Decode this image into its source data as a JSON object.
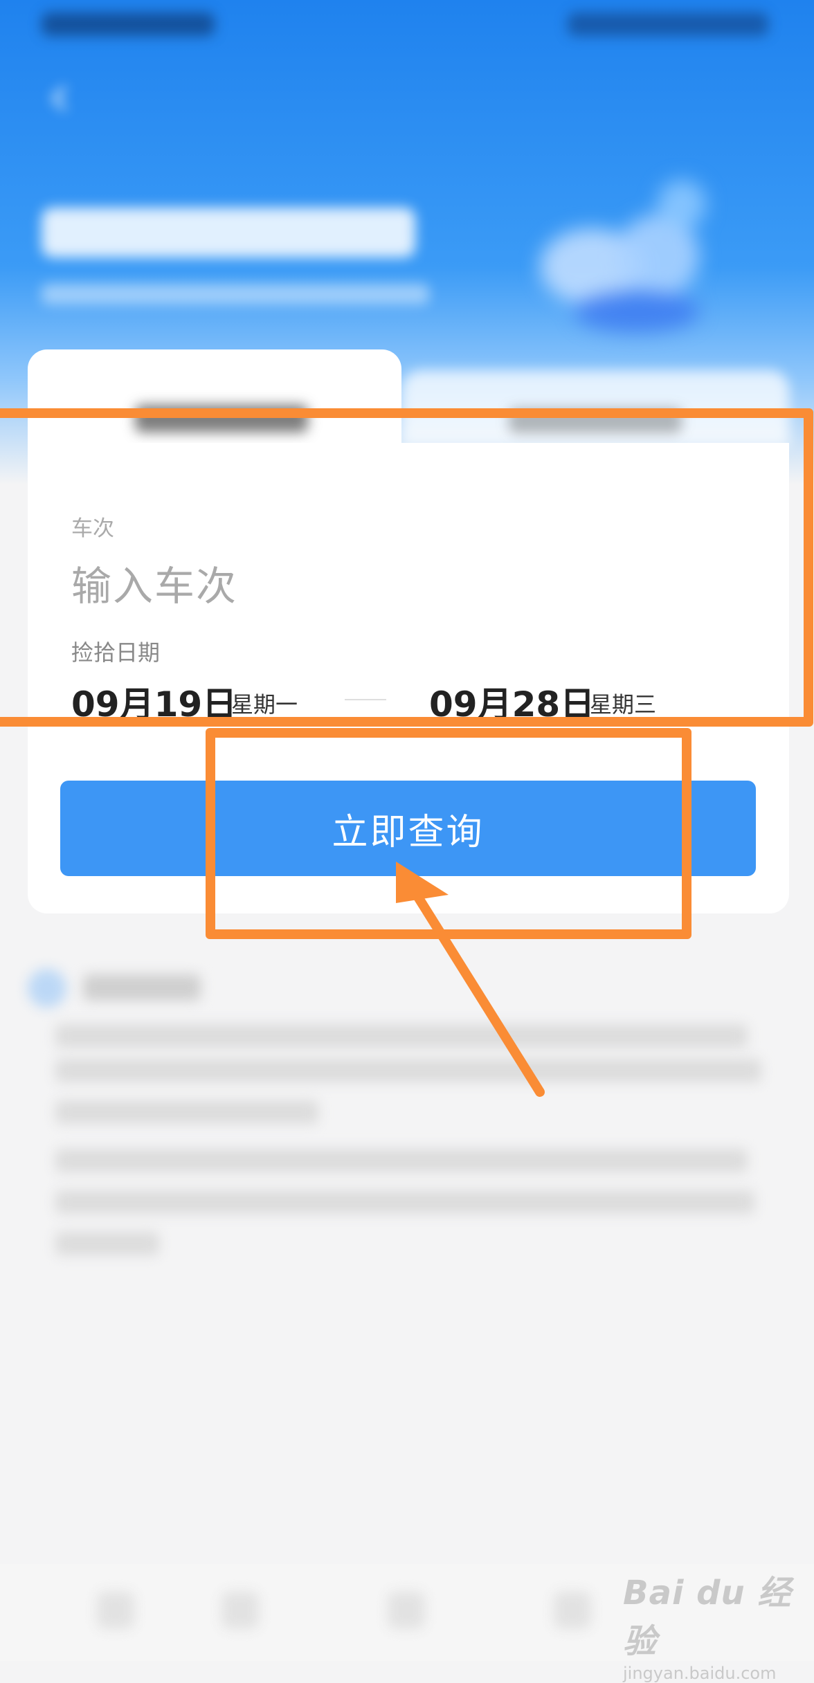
{
  "form": {
    "train_label": "车次",
    "train_placeholder": "输入车次",
    "date_label": "捡拾日期",
    "start_date": "09月19日",
    "start_weekday": "星期一",
    "end_date": "09月28日",
    "end_weekday": "星期三"
  },
  "search_button_label": "立即查询",
  "watermark": {
    "brand": "Bai du 经验",
    "url": "jingyan.baidu.com"
  },
  "colors": {
    "header_blue": "#1f82ee",
    "button_blue": "#3d96f5",
    "annotation_orange": "#fa8c35"
  }
}
